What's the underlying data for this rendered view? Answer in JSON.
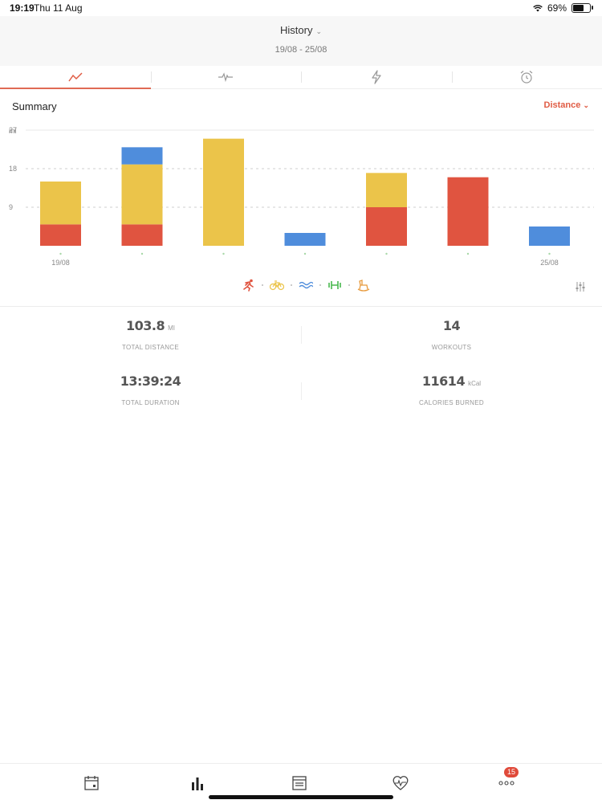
{
  "status": {
    "time": "19:19",
    "date": "Thu 11 Aug",
    "battery": "69%"
  },
  "header": {
    "title": "History",
    "date_range": "19/08 - 25/08"
  },
  "tabs": [
    {
      "icon": "line-chart-icon",
      "active": true
    },
    {
      "icon": "heartbeat-wave-icon",
      "active": false
    },
    {
      "icon": "lightning-icon",
      "active": false
    },
    {
      "icon": "alarm-clock-icon",
      "active": false
    }
  ],
  "summary": {
    "title": "Summary",
    "metric_selector": "Distance"
  },
  "colors": {
    "run": "#e05440",
    "cycle": "#ebc44a",
    "swim": "#4f8ddc",
    "gym": "#48b84e",
    "other": "#e89a3c",
    "accent": "#e06a55"
  },
  "chart_data": {
    "type": "bar",
    "stacked": true,
    "ylabel": "mi",
    "yticks": [
      9,
      18,
      27
    ],
    "ylim": [
      0,
      30
    ],
    "categories": [
      "19/08",
      "",
      "",
      "",
      "",
      "",
      "25/08"
    ],
    "series": [
      {
        "key": "run",
        "values": [
          5,
          5,
          0,
          0,
          9,
          16,
          0
        ]
      },
      {
        "key": "cycle",
        "values": [
          10,
          14,
          25,
          0,
          8,
          0,
          0
        ]
      },
      {
        "key": "swim",
        "values": [
          0,
          4,
          0,
          3,
          0,
          0,
          4.5
        ]
      }
    ],
    "grid": true
  },
  "sports": [
    "running-icon",
    "cycling-icon",
    "swimming-icon",
    "dumbbell-icon",
    "rocking-horse-icon"
  ],
  "stats": {
    "total_distance": {
      "value": "103.8",
      "unit": "MI",
      "label": "TOTAL DISTANCE"
    },
    "workouts": {
      "value": "14",
      "label": "WORKOUTS"
    },
    "total_duration": {
      "value": "13:39:24",
      "label": "TOTAL DURATION"
    },
    "calories": {
      "value": "11614",
      "unit": "kCal",
      "label": "CALORIES BURNED"
    }
  },
  "bottom_nav": {
    "items": [
      "calendar-icon",
      "bar-chart-icon",
      "journal-icon",
      "heart-rate-icon",
      "more-icon"
    ],
    "badge": "15"
  }
}
